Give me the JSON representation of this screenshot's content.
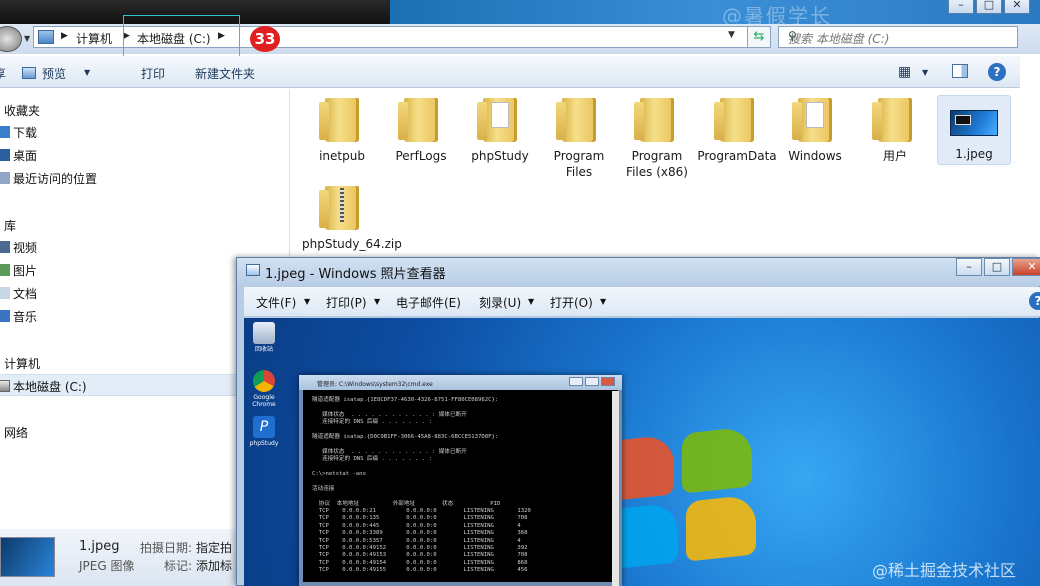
{
  "explorer": {
    "breadcrumb": [
      "计算机",
      "本地磁盘 (C:)"
    ],
    "badge": "33",
    "search_placeholder": "搜索 本地磁盘 (C:)",
    "toolbar": {
      "cut": "享",
      "preview": "预览",
      "print": "打印",
      "new_folder": "新建文件夹"
    },
    "sidebar": {
      "favorites_header": "收藏夹",
      "favorites": [
        "下载",
        "桌面",
        "最近访问的位置"
      ],
      "libraries_header": "库",
      "libraries": [
        "视频",
        "图片",
        "文档",
        "音乐"
      ],
      "computer_header": "计算机",
      "computer_items": [
        "本地磁盘 (C:)"
      ],
      "network_header": "网络"
    },
    "files": [
      {
        "name": "inetpub",
        "type": "folder"
      },
      {
        "name": "PerfLogs",
        "type": "folder"
      },
      {
        "name": "phpStudy",
        "type": "folder-doc"
      },
      {
        "name": "Program Files",
        "type": "folder"
      },
      {
        "name": "Program Files (x86)",
        "type": "folder"
      },
      {
        "name": "ProgramData",
        "type": "folder"
      },
      {
        "name": "Windows",
        "type": "folder-doc"
      },
      {
        "name": "用户",
        "type": "folder"
      },
      {
        "name": "1.jpeg",
        "type": "image",
        "selected": true
      },
      {
        "name": "phpStudy_64.zip",
        "type": "zip"
      }
    ],
    "details": {
      "filename": "1.jpeg",
      "filetype": "JPEG 图像",
      "date_label": "拍摄日期:",
      "date_value": "指定拍",
      "tag_label": "标记:",
      "tag_value": "添加标"
    }
  },
  "viewer": {
    "title": "1.jpeg - Windows 照片查看器",
    "menu": [
      "文件(F)",
      "打印(P)",
      "电子邮件(E)",
      "刻录(U)",
      "打开(O)"
    ],
    "help": "?",
    "desktop_icons": [
      "回收站",
      "Google Chrome",
      "phpStudy"
    ],
    "cmd": {
      "title": "管理员: C:\\Windows\\system32\\cmd.exe",
      "lines": [
        "隧道适配器 isatap.{1E8CDF37-4630-4326-8751-FF80CE08962C}:",
        "",
        "   媒体状态  . . . . . . . . . . . . : 媒体已断开",
        "   连接特定的 DNS 后缀 . . . . . . . :",
        "",
        "隧道适配器 isatap.{D0C9B1FF-3066-45A8-883C-6BCCE5137D8F}:",
        "",
        "   媒体状态  . . . . . . . . . . . . : 媒体已断开",
        "   连接特定的 DNS 后缀 . . . . . . . :",
        "",
        "C:\\>netstat -ano",
        "",
        "活动连接",
        "",
        "  协议  本地地址          外部地址        状态           PID",
        "  TCP    0.0.0.0:21         0.0.0.0:0        LISTENING       1320",
        "  TCP    0.0.0.0:135        0.0.0.0:0        LISTENING       708",
        "  TCP    0.0.0.0:445        0.0.0.0:0        LISTENING       4",
        "  TCP    0.0.0.0:3389       0.0.0.0:0        LISTENING       368",
        "  TCP    0.0.0.0:5357       0.0.0.0:0        LISTENING       4",
        "  TCP    0.0.0.0:49152      0.0.0.0:0        LISTENING       392",
        "  TCP    0.0.0.0:49153      0.0.0.0:0        LISTENING       708",
        "  TCP    0.0.0.0:49154      0.0.0.0:0        LISTENING       868",
        "  TCP    0.0.0.0:49155      0.0.0.0:0        LISTENING       456"
      ]
    }
  },
  "watermarks": {
    "top": "@暑假学长",
    "bottom": "@稀土掘金技术社区"
  }
}
